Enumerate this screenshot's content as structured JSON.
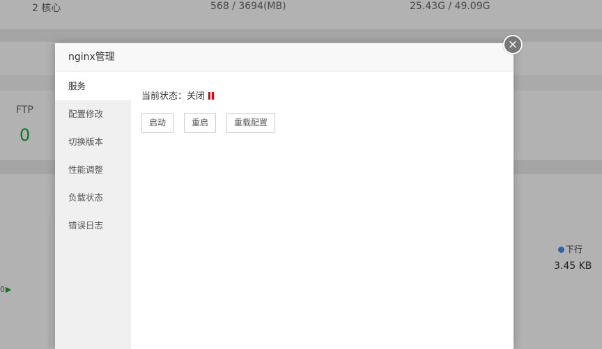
{
  "background": {
    "cpu_cores": "2 核心",
    "memory": "568 / 3694(MB)",
    "disk": "25.43G / 49.09G",
    "ftp_label": "FTP",
    "ftp_count": "0",
    "download_label": "下行",
    "download_value": "3.45 KB",
    "chart_edge_label": "0"
  },
  "modal": {
    "title": "nginx管理",
    "close_label": "×",
    "sidebar": [
      {
        "label": "服务",
        "active": true
      },
      {
        "label": "配置修改"
      },
      {
        "label": "切换版本"
      },
      {
        "label": "性能调整"
      },
      {
        "label": "负载状态"
      },
      {
        "label": "错误日志"
      }
    ],
    "status_label": "当前状态：",
    "status_value": "关闭",
    "status_icon": "pause-icon",
    "status_color": "#e60000",
    "buttons": {
      "start": "启动",
      "restart": "重启",
      "reload": "重载配置"
    }
  }
}
